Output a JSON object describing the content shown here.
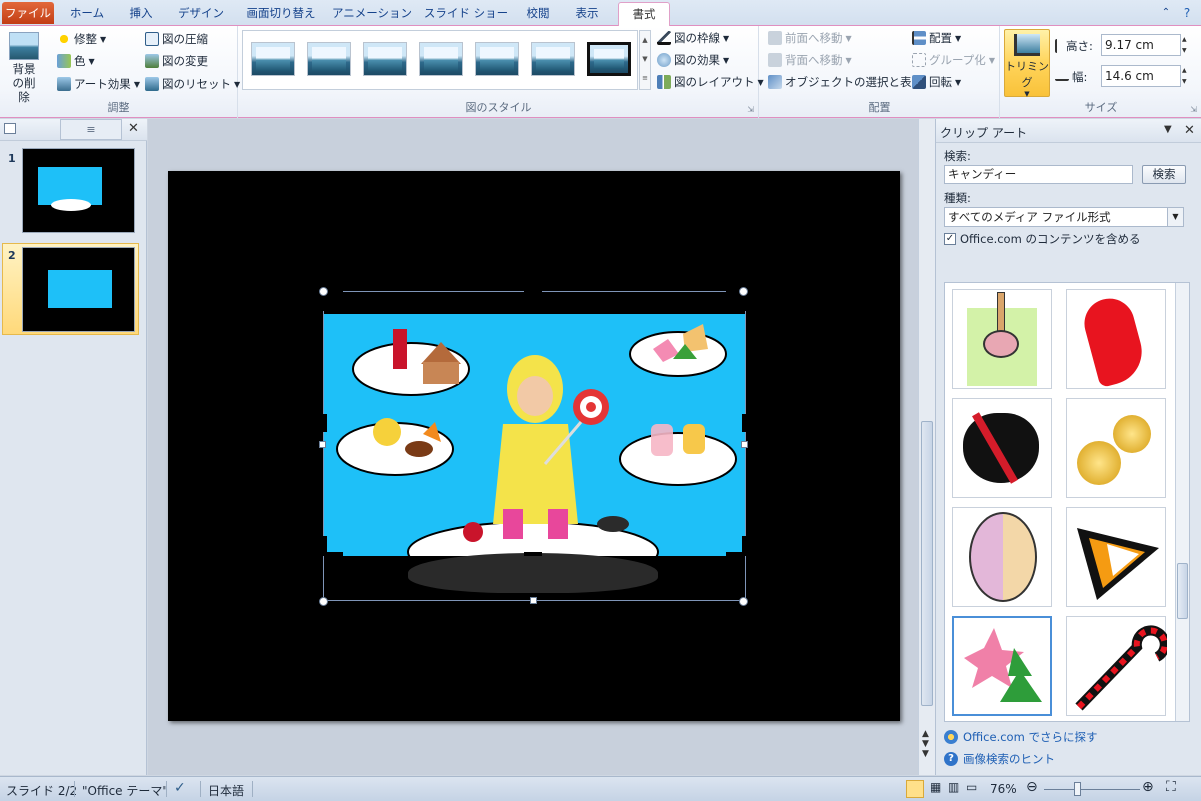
{
  "tabs": [
    "ファイル",
    "ホーム",
    "挿入",
    "デザイン",
    "画面切り替え",
    "アニメーション",
    "スライド ショー",
    "校閲",
    "表示",
    "書式"
  ],
  "ribbon": {
    "adjust": {
      "remove_bg": "背景の削除",
      "corrections": "修整",
      "color": "色",
      "artistic": "アート効果",
      "compress": "図の圧縮",
      "change": "図の変更",
      "reset": "図のリセット",
      "label": "調整"
    },
    "styles": {
      "label": "図のスタイル",
      "border": "図の枠線",
      "effects": "図の効果",
      "layout": "図のレイアウト"
    },
    "arrange": {
      "forward": "前面へ移動",
      "backward": "背面へ移動",
      "selection": "オブジェクトの選択と表示",
      "align": "配置",
      "group": "グループ化",
      "rotate": "回転",
      "label": "配置"
    },
    "size": {
      "crop": "トリミング",
      "height_label": "高さ:",
      "height_value": "9.17 cm",
      "width_label": "幅:",
      "width_value": "14.6 cm",
      "label": "サイズ"
    }
  },
  "slides_pane": {
    "numbers": [
      "1",
      "2"
    ]
  },
  "clipart_pane": {
    "title": "クリップ アート",
    "search_label": "検索:",
    "search_value": "キャンディー",
    "search_button": "検索",
    "type_label": "種類:",
    "type_value": "すべてのメディア ファイル形式",
    "include_office": "Office.com のコンテンツを含める",
    "more_link": "Office.com でさらに探す",
    "hint_link": "画像検索のヒント",
    "items": [
      "lollipop",
      "candy-cane-ribbon",
      "candy-heart",
      "gold-coins",
      "candy-cane-egg",
      "candy-corn",
      "star-tree-cookies",
      "candy-cane"
    ]
  },
  "statusbar": {
    "slide": "スライド 2/2",
    "theme": "\"Office テーマ\"",
    "language": "日本語",
    "zoom": "76%"
  },
  "colors": {
    "file_tab": "#d24f23",
    "slide_bg": "#000000",
    "picture_bg": "#1ec0f8"
  }
}
